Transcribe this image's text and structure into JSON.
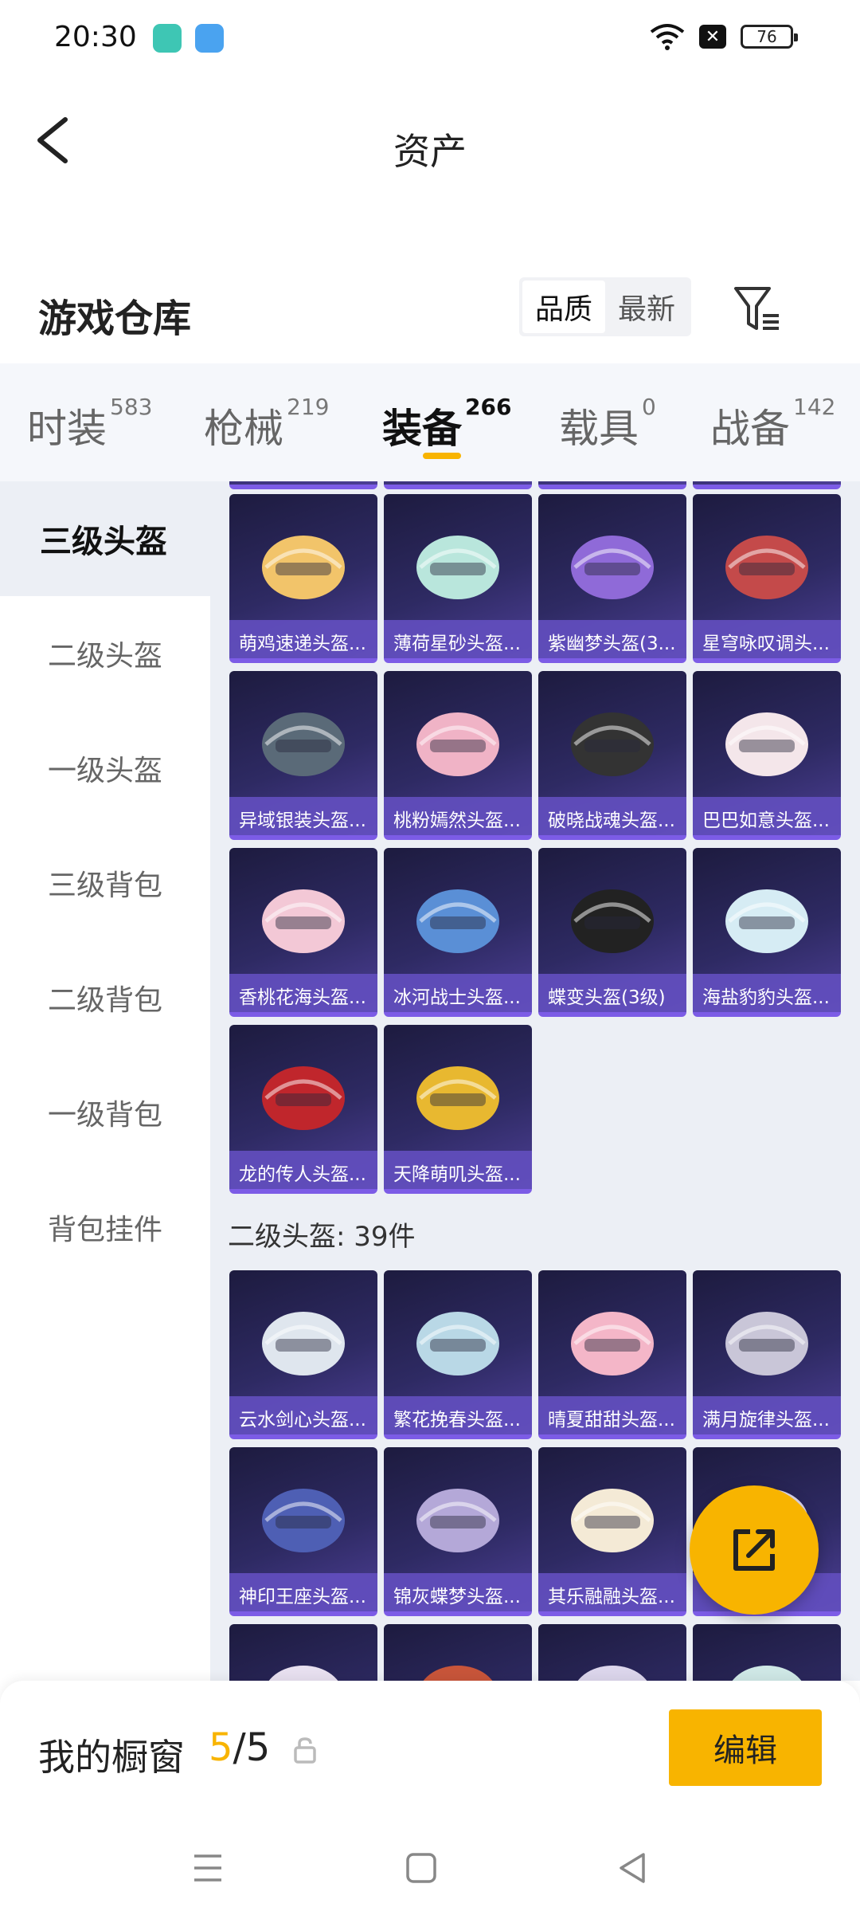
{
  "status_bar": {
    "time": "20:30",
    "battery": "76"
  },
  "header": {
    "title": "资产"
  },
  "warehouse": {
    "title": "游戏仓库",
    "sort_options": [
      "品质",
      "最新"
    ]
  },
  "tabs": [
    {
      "label": "时装",
      "count": "583"
    },
    {
      "label": "枪械",
      "count": "219"
    },
    {
      "label": "装备",
      "count": "266"
    },
    {
      "label": "载具",
      "count": "0"
    },
    {
      "label": "战备",
      "count": "142"
    }
  ],
  "sidebar": {
    "items": [
      "三级头盔",
      "二级头盔",
      "一级头盔",
      "三级背包",
      "二级背包",
      "一级背包",
      "背包挂件"
    ]
  },
  "grid": {
    "level3_items": [
      "萌鸡速递头盔...",
      "薄荷星砂头盔...",
      "紫幽梦头盔(3...",
      "星穹咏叹调头...",
      "异域银装头盔...",
      "桃粉嫣然头盔...",
      "破晓战魂头盔...",
      "巴巴如意头盔...",
      "香桃花海头盔...",
      "冰河战士头盔...",
      "蝶变头盔(3级)",
      "海盐豹豹头盔...",
      "龙的传人头盔...",
      "天降萌叽头盔..."
    ],
    "level2_section_title": "二级头盔: 39件",
    "level2_items": [
      "云水剑心头盔...",
      "繁花挽春头盔...",
      "晴夏甜甜头盔...",
      "满月旋律头盔...",
      "神印王座头盔...",
      "锦灰蝶梦头盔...",
      "其乐融融头盔...",
      ""
    ]
  },
  "showcase": {
    "title": "我的橱窗",
    "current": "5",
    "separator": "/",
    "total": "5",
    "edit_label": "编辑"
  },
  "colors": {
    "accent": "#f8b400",
    "card_purple": "#6a52c8"
  }
}
